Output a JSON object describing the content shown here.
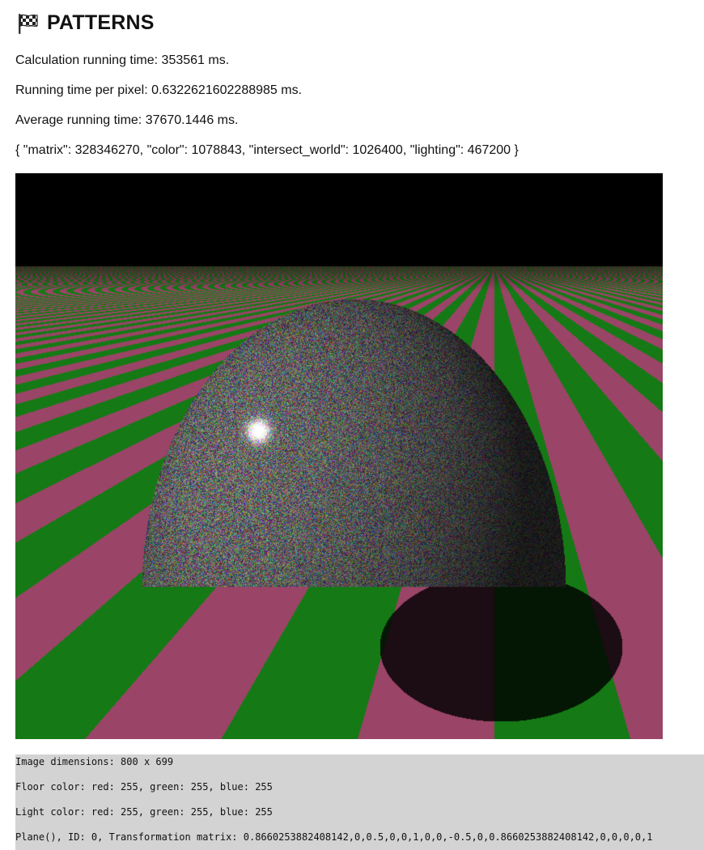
{
  "header": {
    "icon": "checkered-flag-icon",
    "title": "PATTERNS"
  },
  "stats": {
    "calc_time": "Calculation running time: 353561 ms.",
    "per_pixel": "Running time per pixel: 0.6322621602288985 ms.",
    "average": "Average running time: 37670.1446 ms.",
    "counts": "{ \"matrix\": 328346270, \"color\": 1078843, \"intersect_world\": 1026400, \"lighting\": 467200 }"
  },
  "render": {
    "colors": {
      "sky": "#000000",
      "stripe_pink": "#9a4467",
      "stripe_green": "#157a15",
      "sphere_base": "#6a6a6a"
    }
  },
  "log": {
    "lines": [
      "Image dimensions: 800 x 699",
      "Floor color: red: 255, green: 255, blue: 255",
      "Light color: red: 255, green: 255, blue: 255",
      "Plane(), ID: 0, Transformation matrix: 0.8660253882408142,0,0.5,0,0,1,0,0,-0.5,0,0.8660253882408142,0,0,0,0,1"
    ]
  }
}
